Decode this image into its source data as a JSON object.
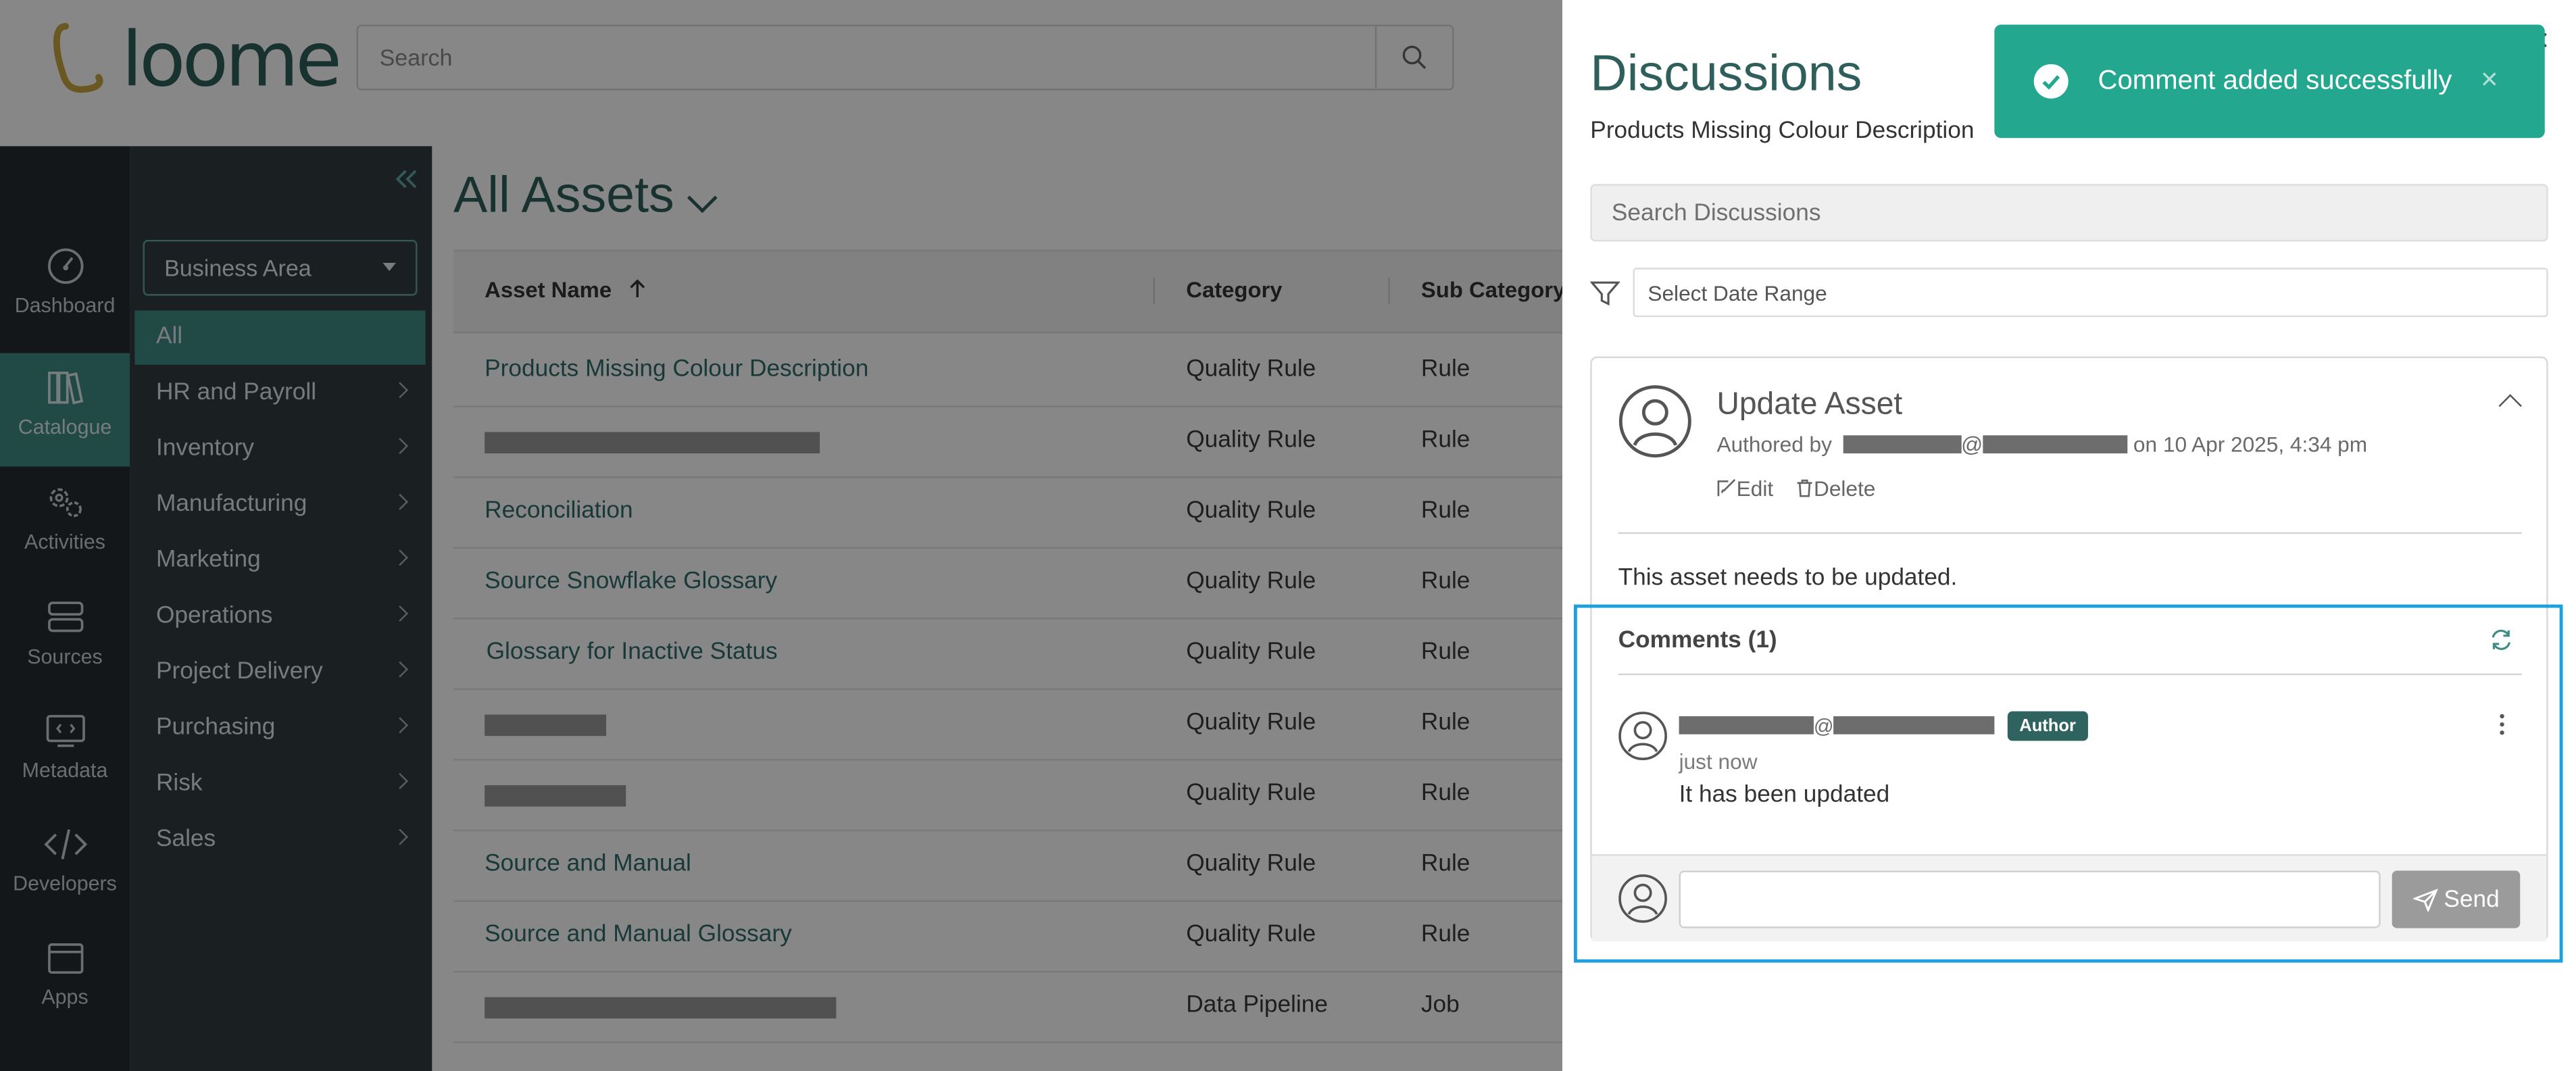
{
  "app": {
    "logo_text": "loome"
  },
  "header": {
    "search_placeholder": "Search"
  },
  "rail": [
    {
      "label": "Dashboard",
      "icon": "dashboard-icon"
    },
    {
      "label": "Catalogue",
      "icon": "catalogue-icon",
      "active": true
    },
    {
      "label": "Activities",
      "icon": "activities-icon"
    },
    {
      "label": "Sources",
      "icon": "sources-icon"
    },
    {
      "label": "Metadata",
      "icon": "metadata-icon"
    },
    {
      "label": "Developers",
      "icon": "developers-icon"
    },
    {
      "label": "Apps",
      "icon": "apps-icon"
    }
  ],
  "subnav": {
    "filter_select": "Business Area",
    "items": [
      "All",
      "HR and Payroll",
      "Inventory",
      "Manufacturing",
      "Marketing",
      "Operations",
      "Project Delivery",
      "Purchasing",
      "Risk",
      "Sales"
    ]
  },
  "main": {
    "title": "All Assets",
    "columns": [
      "Asset Name",
      "Category",
      "Sub Category"
    ],
    "rows": [
      {
        "name": "Products Missing Colour Description",
        "category": "Quality Rule",
        "sub": "Rule"
      },
      {
        "name": "",
        "category": "Quality Rule",
        "sub": "Rule"
      },
      {
        "name": "Reconciliation",
        "category": "Quality Rule",
        "sub": "Rule"
      },
      {
        "name": "Source Snowflake Glossary",
        "category": "Quality Rule",
        "sub": "Rule"
      },
      {
        "name": "Glossary for Inactive Status",
        "category": "Quality Rule",
        "sub": "Rule"
      },
      {
        "name": "",
        "category": "Quality Rule",
        "sub": "Rule"
      },
      {
        "name": "",
        "category": "Quality Rule",
        "sub": "Rule"
      },
      {
        "name": "Source and Manual",
        "category": "Quality Rule",
        "sub": "Rule"
      },
      {
        "name": "Source and Manual Glossary",
        "category": "Quality Rule",
        "sub": "Rule"
      },
      {
        "name": "",
        "category": "Data Pipeline",
        "sub": "Job"
      }
    ]
  },
  "drawer": {
    "title": "Discussions",
    "subtitle": "Products Missing Colour Description",
    "search_placeholder": "Search Discussions",
    "date_placeholder": "Select Date Range",
    "discussion": {
      "title": "Update Asset",
      "authored_prefix": "Authored by",
      "at_sign": "@",
      "date_text": "on 10 Apr 2025, 4:34 pm",
      "edit_label": "Edit",
      "delete_label": "Delete",
      "body": "This asset needs to be updated."
    },
    "comments": {
      "header": "Comments (1)",
      "items": [
        {
          "at_sign": "@",
          "badge": "Author",
          "time": "just now",
          "text": "It has been updated"
        }
      ]
    },
    "send_label": "Send"
  },
  "toast": {
    "message": "Comment added successfully",
    "close": "×"
  },
  "colors": {
    "brand": "#2f5f5a",
    "accent": "#3f8c86",
    "toast": "#23a78e",
    "highlight": "#1ea0df",
    "badge": "#2f6360"
  }
}
